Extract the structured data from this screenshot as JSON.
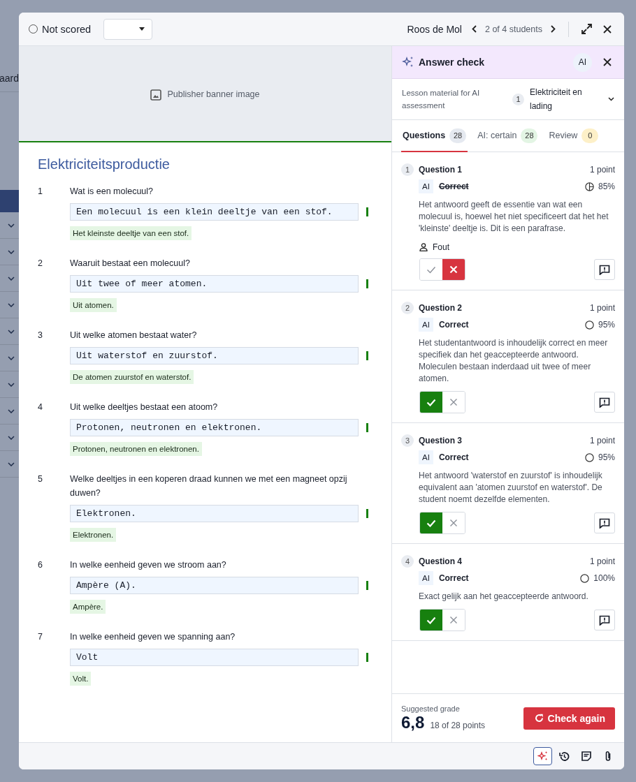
{
  "backdrop": {
    "label": "aard"
  },
  "header": {
    "score_status": "Not scored",
    "student": "Roos de Mol",
    "position": "2 of 4 students"
  },
  "banner": {
    "label": "Publisher banner image"
  },
  "document": {
    "title": "Elektriciteitsproductie",
    "questions": [
      {
        "number": "1",
        "text": "Wat is een molecuul?",
        "answer": "Een molecuul is een klein deeltje van een stof.",
        "accepted": "Het kleinste deeltje van een stof.",
        "correct": true
      },
      {
        "number": "2",
        "text": "Waaruit bestaat een molecuul?",
        "answer": "Uit twee of meer atomen.",
        "accepted": "Uit atomen.",
        "correct": true
      },
      {
        "number": "3",
        "text": "Uit welke atomen bestaat water?",
        "answer": "Uit waterstof en zuurstof.",
        "accepted": "De atomen zuurstof en waterstof.",
        "correct": true
      },
      {
        "number": "4",
        "text": "Uit welke deeltjes bestaat een atoom?",
        "answer": "Protonen, neutronen en elektronen.",
        "accepted": "Protonen, neutronen en elektronen.",
        "correct": true
      },
      {
        "number": "5",
        "text": "Welke deeltjes in een koperen draad kunnen we met een magneet opzij duwen?",
        "answer": "Elektronen.",
        "accepted": "Elektronen.",
        "correct": true
      },
      {
        "number": "6",
        "text": "In welke eenheid geven we stroom aan?",
        "answer": "Ampère (A).",
        "accepted": "Ampère.",
        "correct": true
      },
      {
        "number": "7",
        "text": "In welke eenheid geven we spanning aan?",
        "answer": "Volt",
        "accepted": "Volt.",
        "correct": true
      }
    ]
  },
  "answer_check": {
    "title": "Answer check",
    "badge": "AI",
    "lesson_material": {
      "label": "Lesson material for AI assessment",
      "count": "1",
      "value": "Elektriciteit en lading"
    },
    "tabs": [
      {
        "label": "Questions",
        "count": "28",
        "selected": true,
        "color": "#e5e9f0"
      },
      {
        "label": "AI: certain",
        "count": "28",
        "selected": false,
        "color": "#e3f5e4"
      },
      {
        "label": "Review",
        "count": "0",
        "selected": false,
        "color": "#fdf0c8"
      }
    ],
    "results": [
      {
        "number": "1",
        "title": "Question 1",
        "points": "1 point",
        "ai_tag": "AI",
        "verdict": "Correct",
        "overridden": true,
        "confidence": "85%",
        "partial_confidence": true,
        "explanation": "Het antwoord geeft de essentie van wat een molecuul is, hoewel het niet specificeert dat het het 'kleinste' deeltje is. Dit is een parafrase.",
        "teacher_verdict": "Fout",
        "marked_correct": false
      },
      {
        "number": "2",
        "title": "Question 2",
        "points": "1 point",
        "ai_tag": "AI",
        "verdict": "Correct",
        "overridden": false,
        "confidence": "95%",
        "partial_confidence": false,
        "explanation": "Het studentantwoord is inhoudelijk correct en meer specifiek dan het geaccepteerde antwoord. Moleculen bestaan inderdaad uit twee of meer atomen.",
        "marked_correct": true
      },
      {
        "number": "3",
        "title": "Question 3",
        "points": "1 point",
        "ai_tag": "AI",
        "verdict": "Correct",
        "overridden": false,
        "confidence": "95%",
        "partial_confidence": false,
        "explanation": "Het antwoord 'waterstof en zuurstof' is inhoudelijk equivalent aan 'atomen zuurstof en waterstof'. De student noemt dezelfde elementen.",
        "marked_correct": true
      },
      {
        "number": "4",
        "title": "Question 4",
        "points": "1 point",
        "ai_tag": "AI",
        "verdict": "Correct",
        "overridden": false,
        "confidence": "100%",
        "partial_confidence": false,
        "explanation": "Exact gelijk aan het geaccepteerde antwoord.",
        "marked_correct": true
      }
    ],
    "suggested_grade": {
      "label": "Suggested grade",
      "value": "6,8",
      "points": "18 of 28 points"
    },
    "check_button": "Check again"
  },
  "toolbar": [
    {
      "kind": "ai",
      "selected": true
    },
    {
      "kind": "history",
      "selected": false
    },
    {
      "kind": "notes",
      "selected": false
    },
    {
      "kind": "attachments",
      "selected": false
    }
  ]
}
